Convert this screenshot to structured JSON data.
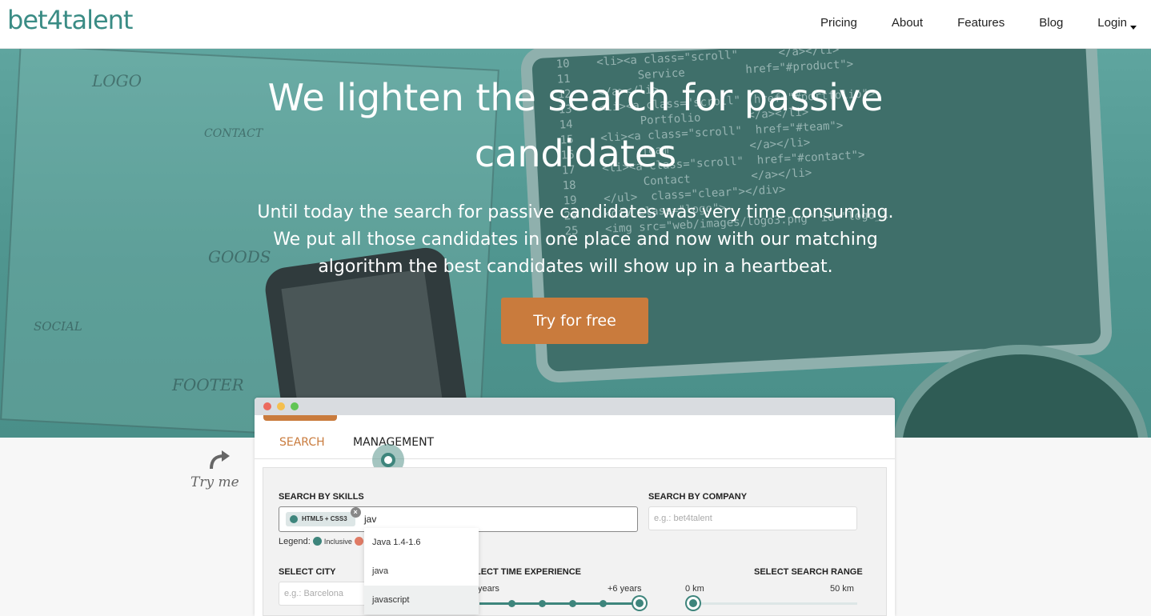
{
  "nav": {
    "logo": "bet4talent",
    "links": [
      "Pricing",
      "About",
      "Features",
      "Blog",
      "Login"
    ]
  },
  "hero": {
    "title_line1": "We lighten the search for passive",
    "title_line2": "candidates",
    "subtitle_line1": "Until today the search for passive candidates was very time consuming.",
    "subtitle_line2": "We put all those candidates in one place and now with our matching",
    "subtitle_line3": "algorithm the best candidates will show up in a heartbeat.",
    "cta": "Try for free"
  },
  "demo": {
    "tabs": [
      "SEARCH",
      "MANAGEMENT"
    ],
    "search_by_skills": "SEARCH BY SKILLS",
    "skill_chip": "HTML5 + CSS3",
    "typed": "jav",
    "search_by_company": "SEARCH BY COMPANY",
    "company_placeholder": "e.g.: bet4talent",
    "legend_label": "Legend:",
    "legend_inclusive": "Inclusive",
    "dropdown": [
      "Java 1.4-1.6",
      "java",
      "javascript"
    ],
    "select_city": "SELECT CITY",
    "city_placeholder": "e.g.: Barcelona",
    "select_time": "LECT TIME EXPERIENCE",
    "time_min": "years",
    "time_max": "+6 years",
    "select_range": "SELECT SEARCH RANGE",
    "range_min": "0 km",
    "range_max": "50 km"
  },
  "tryme": "Try me",
  "colors": {
    "accent": "#c97b3d",
    "teal": "#3e857c",
    "logo": "#3a8c85"
  }
}
